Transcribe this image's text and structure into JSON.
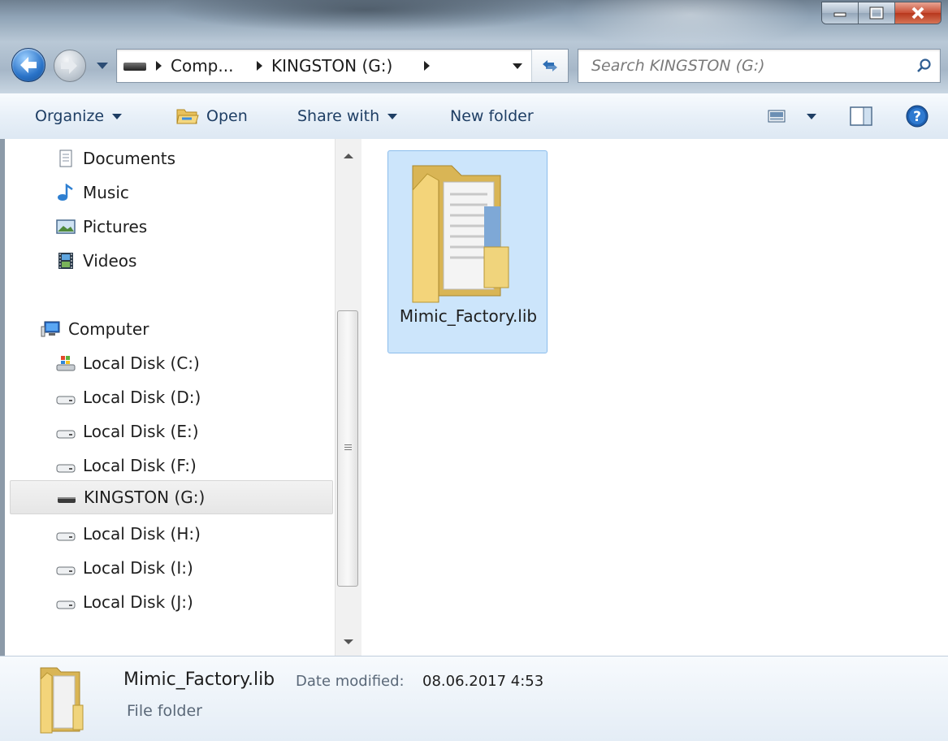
{
  "window": {
    "minimize_icon": "minimize-icon",
    "maximize_icon": "maximize-icon",
    "close_icon": "close-icon"
  },
  "address_bar": {
    "crumbs": [
      "Comp...",
      "KINGSTON (G:)"
    ]
  },
  "search": {
    "placeholder": "Search KINGSTON (G:)"
  },
  "toolbar": {
    "organize": "Organize",
    "open": "Open",
    "share_with": "Share with",
    "new_folder": "New folder"
  },
  "sidebar": {
    "libraries": [
      "Documents",
      "Music",
      "Pictures",
      "Videos"
    ],
    "computer": "Computer",
    "drives": [
      "Local Disk (C:)",
      "Local Disk (D:)",
      "Local Disk (E:)",
      "Local Disk (F:)",
      "KINGSTON (G:)",
      "Local Disk (H:)",
      "Local Disk (I:)",
      "Local Disk (J:)"
    ],
    "selected": "KINGSTON (G:)"
  },
  "content": {
    "items": [
      {
        "name": "Mimic_Factory.lib",
        "type": "folder"
      }
    ]
  },
  "details": {
    "name": "Mimic_Factory.lib",
    "date_label": "Date modified:",
    "date_value": "08.06.2017 4:53",
    "type": "File folder"
  },
  "colors": {
    "selection": "#cce5fb",
    "toolbar_text": "#1e3e64"
  }
}
